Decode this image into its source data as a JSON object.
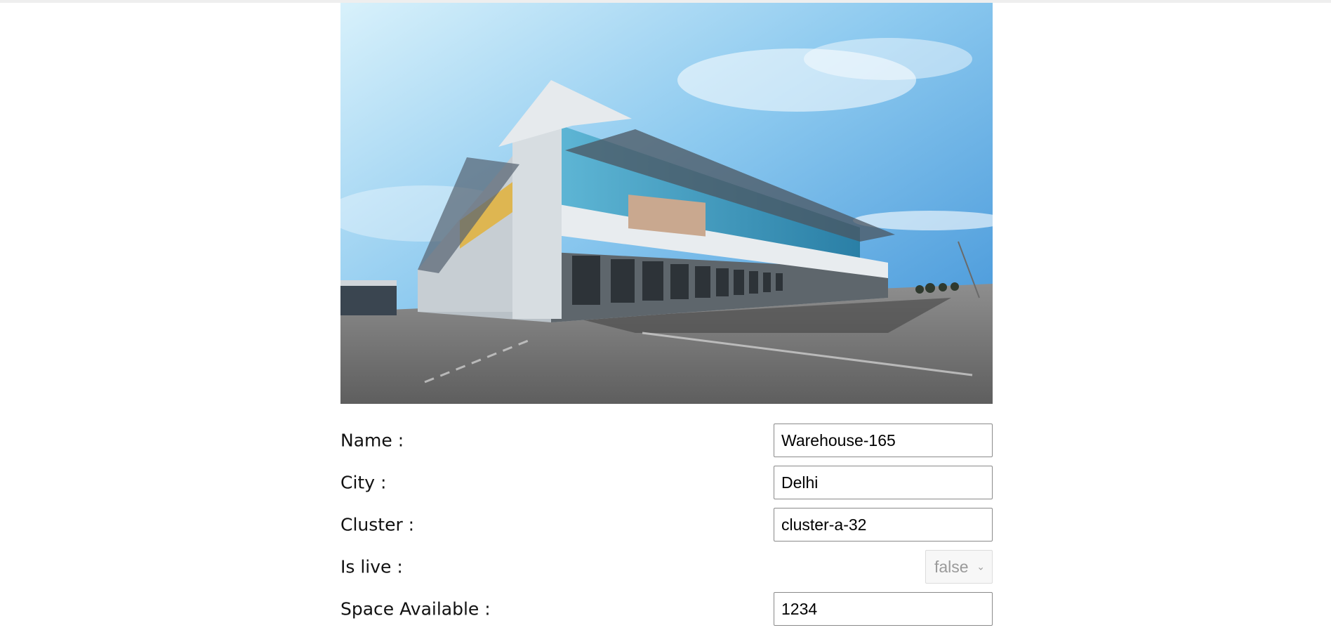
{
  "warehouse": {
    "image_alt": "warehouse-building-photo",
    "fields": {
      "name": {
        "label": "Name :",
        "value": "Warehouse-165"
      },
      "city": {
        "label": "City :",
        "value": "Delhi"
      },
      "cluster": {
        "label": "Cluster :",
        "value": "cluster-a-32"
      },
      "is_live": {
        "label": "Is live :",
        "value": "false"
      },
      "space_available": {
        "label": "Space Available :",
        "value": "1234"
      }
    }
  },
  "colors": {
    "sky_top": "#5fa8e6",
    "sky_light": "#cfeafa",
    "ground": "#7d7d7d",
    "glass": "#2f8fb5",
    "accent_yellow": "#e2b23a"
  },
  "icons": {
    "dropdown": "chevron-down-icon"
  }
}
